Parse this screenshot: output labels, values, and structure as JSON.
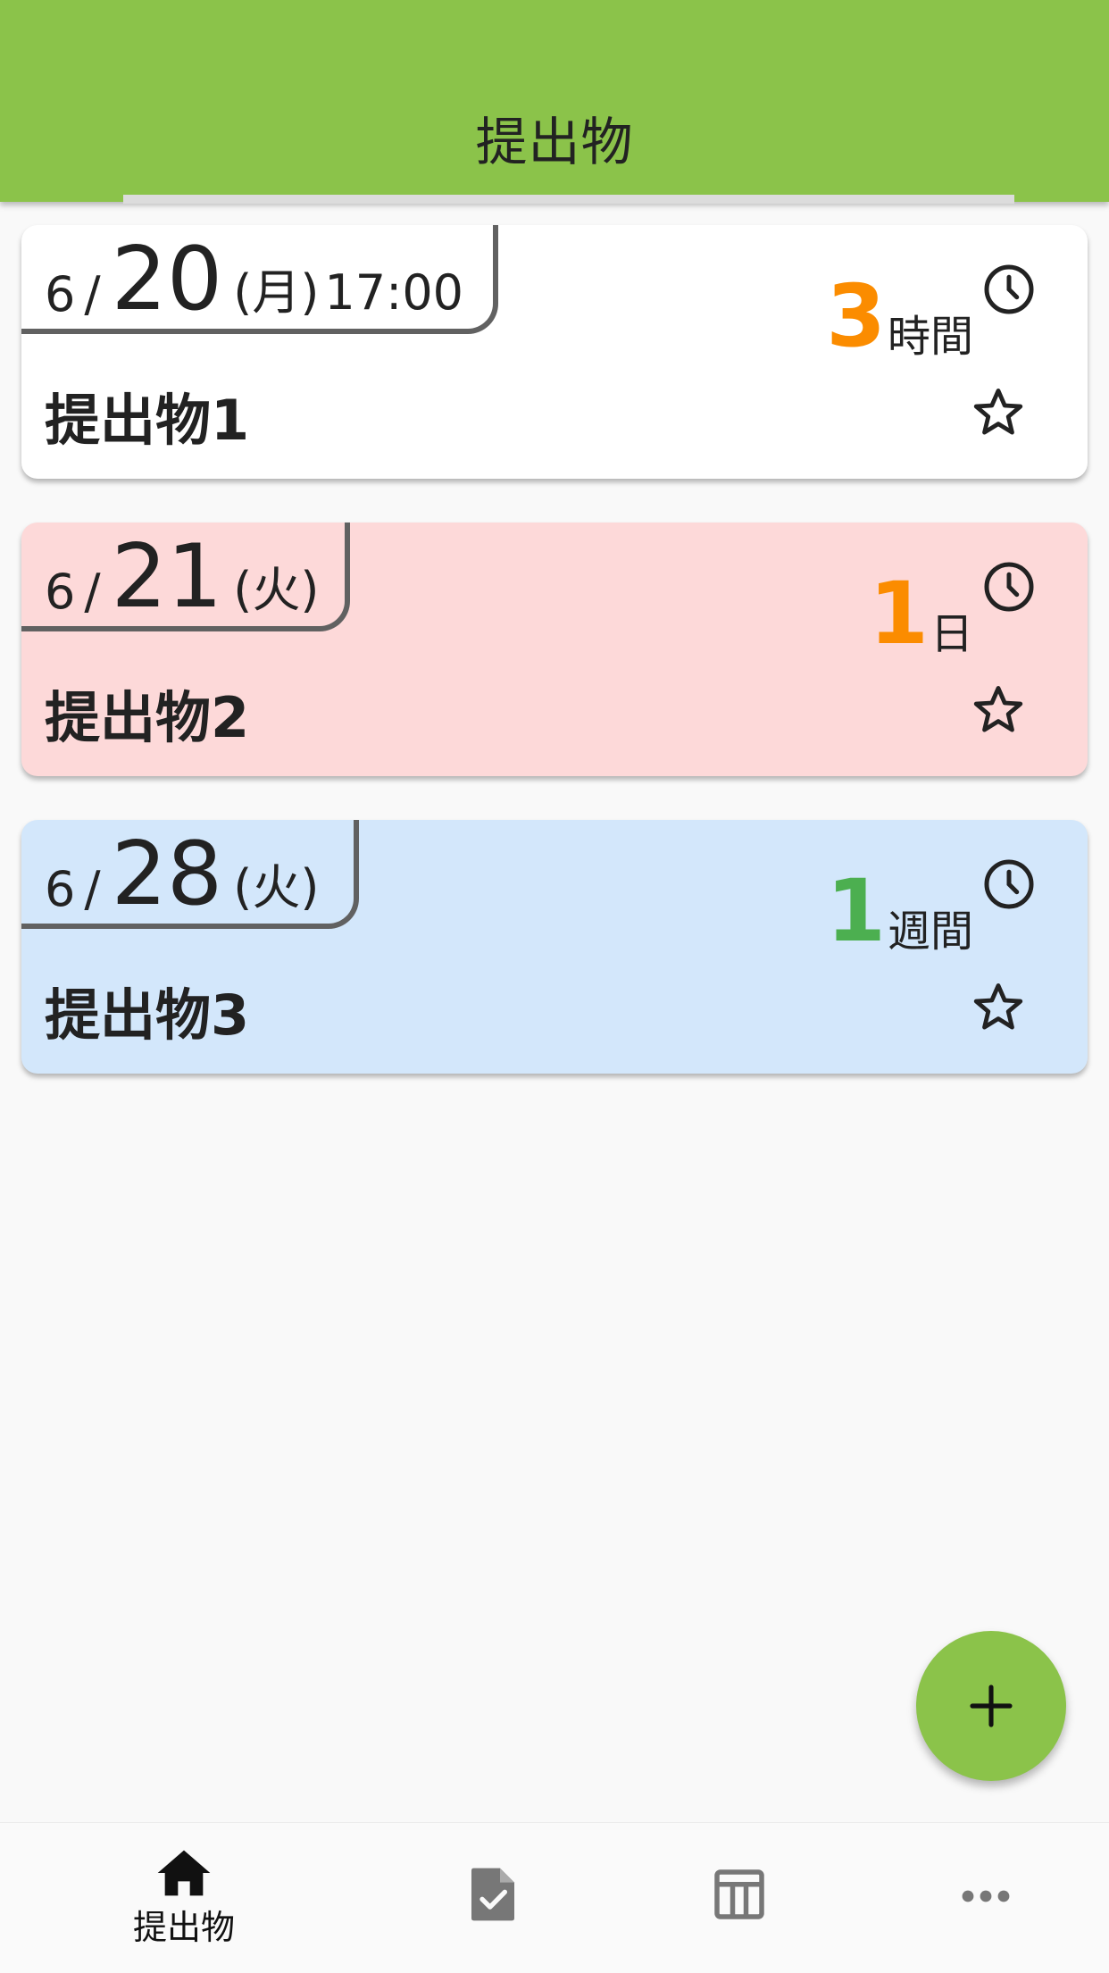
{
  "appbar": {
    "title": "提出物",
    "color": "#8bc34a"
  },
  "cards": [
    {
      "bg": "#ffffff",
      "month": "6",
      "day": "20",
      "weekday": "(月)",
      "time": "17:00",
      "remain_num": "3",
      "remain_unit": "時間",
      "remain_color": "#fb8c00",
      "name": "提出物1",
      "icons": [
        "clock-icon",
        "star-outline-icon"
      ]
    },
    {
      "bg": "#fdd9d9",
      "month": "6",
      "day": "21",
      "weekday": "(火)",
      "time": "",
      "remain_num": "1",
      "remain_unit": "日",
      "remain_color": "#fb8c00",
      "name": "提出物2",
      "icons": [
        "clock-icon",
        "star-outline-icon"
      ]
    },
    {
      "bg": "#d3e7fb",
      "month": "6",
      "day": "28",
      "weekday": "(火)",
      "time": "",
      "remain_num": "1",
      "remain_unit": "週間",
      "remain_color": "#4caf50",
      "name": "提出物3",
      "icons": [
        "clock-icon",
        "star-outline-icon"
      ]
    }
  ],
  "fab": {
    "icon": "plus-icon"
  },
  "bottom_nav": [
    {
      "icon": "home-icon",
      "label": "提出物",
      "active": true
    },
    {
      "icon": "assignment-check-icon",
      "label": ""
    },
    {
      "icon": "table-icon",
      "label": ""
    },
    {
      "icon": "more-horiz-icon",
      "label": ""
    }
  ]
}
